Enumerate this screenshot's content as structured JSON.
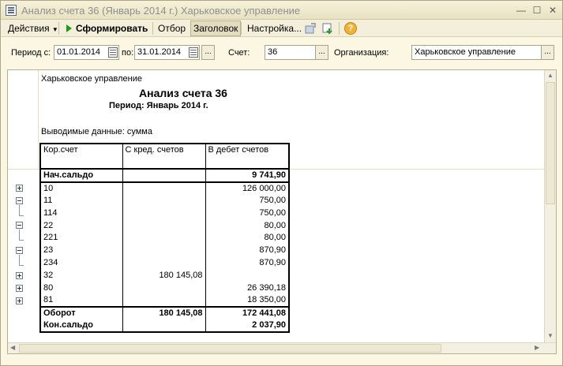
{
  "window": {
    "title": "Анализ счета 36 (Январь 2014 г.) Харьковское управление"
  },
  "toolbar": {
    "actions_label": "Действия",
    "generate_label": "Сформировать",
    "filter_label": "Отбор",
    "header_label": "Заголовок",
    "settings_label": "Настройка...",
    "help_label": "?"
  },
  "filters": {
    "period_from_label": "Период с:",
    "period_from_value": "01.01.2014",
    "period_to_label": "по:",
    "period_to_value": "31.01.2014",
    "account_label": "Счет:",
    "account_value": "36",
    "organization_label": "Организация:",
    "organization_value": "Харьковское управление",
    "select_button": "..."
  },
  "report": {
    "organization": "Харьковское управление",
    "title": "Анализ счета 36",
    "period": "Период: Январь 2014 г.",
    "output": "Выводимые данные: сумма",
    "columns": [
      "Кор.счет",
      "С кред. счетов",
      "В дебет счетов"
    ],
    "opening": {
      "label": "Нач.сальдо",
      "credit": "",
      "debit": "9 741,90"
    },
    "rows": [
      {
        "account": "10",
        "credit": "",
        "debit": "126 000,00"
      },
      {
        "account": "11",
        "credit": "",
        "debit": "750,00"
      },
      {
        "account": "114",
        "credit": "",
        "debit": "750,00"
      },
      {
        "account": "22",
        "credit": "",
        "debit": "80,00"
      },
      {
        "account": "221",
        "credit": "",
        "debit": "80,00"
      },
      {
        "account": "23",
        "credit": "",
        "debit": "870,90"
      },
      {
        "account": "234",
        "credit": "",
        "debit": "870,90"
      },
      {
        "account": "32",
        "credit": "180 145,08",
        "debit": ""
      },
      {
        "account": "80",
        "credit": "",
        "debit": "26 390,18"
      },
      {
        "account": "81",
        "credit": "",
        "debit": "18 350,00"
      }
    ],
    "turnover": {
      "label": "Оборот",
      "credit": "180 145,08",
      "debit": "172 441,08"
    },
    "closing": {
      "label": "Кон.сальдо",
      "credit": "",
      "debit": "2 037,90"
    }
  }
}
